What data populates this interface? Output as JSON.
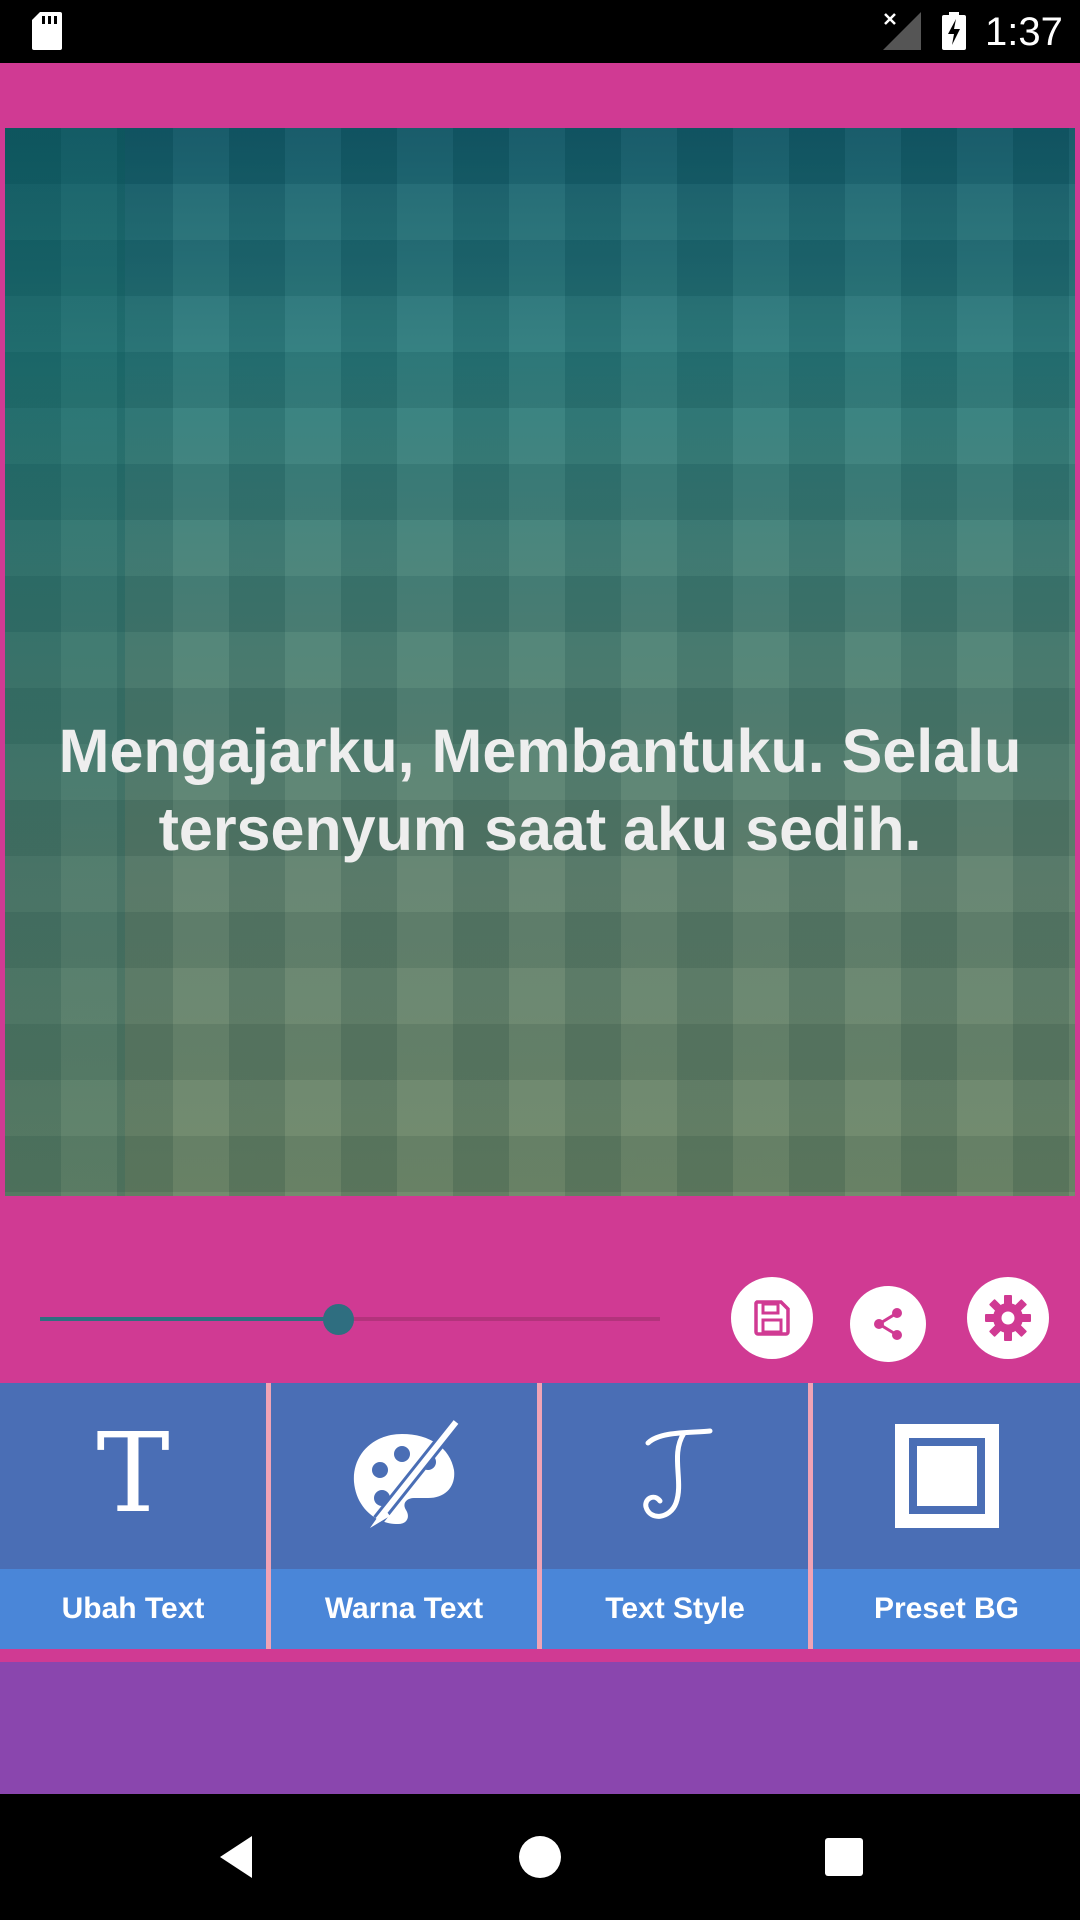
{
  "status_bar": {
    "time": "1:37"
  },
  "preview": {
    "quote": "Mengajarku, Membantuku. Selalu tersenyum saat aku sedih."
  },
  "controls": {
    "slider_value_fraction": 0.48
  },
  "tools": [
    {
      "label": "Ubah Text",
      "icon": "text-t-icon"
    },
    {
      "label": "Warna Text",
      "icon": "palette-icon"
    },
    {
      "label": "Text Style",
      "icon": "script-t-icon"
    },
    {
      "label": "Preset BG",
      "icon": "square-frame-icon"
    }
  ],
  "colors": {
    "background": "#d03a93",
    "tool_icon_bg": "#4a6eb5",
    "tool_label_bg": "#4a86d8",
    "ad_area": "#8a46ae",
    "accent": "#2f6e80"
  }
}
